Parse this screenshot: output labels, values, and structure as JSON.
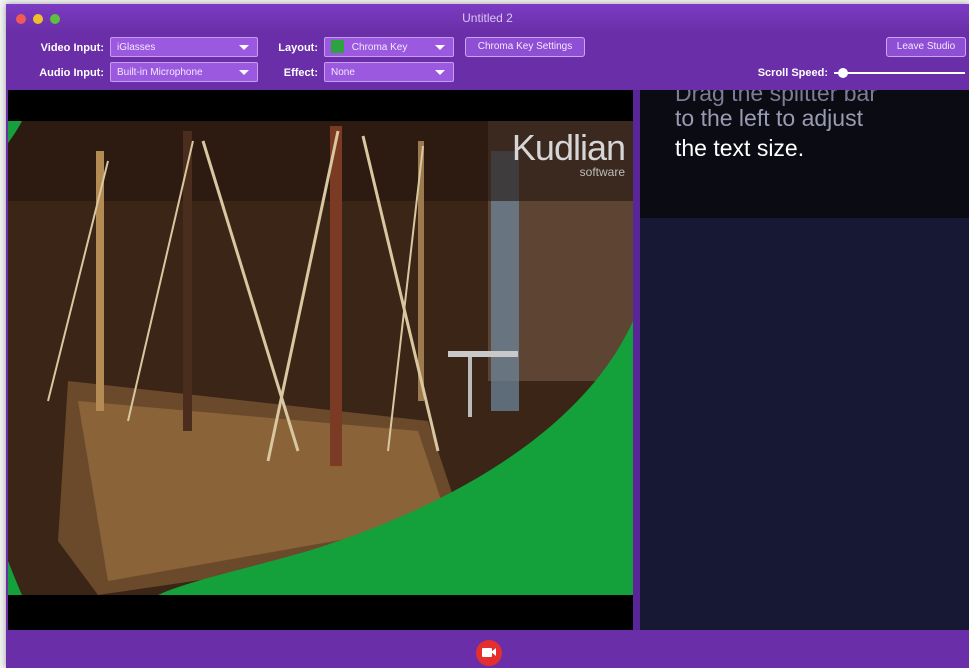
{
  "window": {
    "title": "Untitled 2"
  },
  "toolbar": {
    "video_input_label": "Video Input:",
    "video_input_value": "iGlasses",
    "audio_input_label": "Audio Input:",
    "audio_input_value": "Built-in Microphone",
    "layout_label": "Layout:",
    "layout_value": "Chroma Key",
    "effect_label": "Effect:",
    "effect_value": "None",
    "chroma_settings_button": "Chroma Key Settings",
    "leave_studio_button": "Leave Studio",
    "scroll_speed_label": "Scroll Speed:",
    "scroll_speed_fraction": 0.07
  },
  "video": {
    "watermark_brand": "Kudlian",
    "watermark_sub": "software"
  },
  "prompter": {
    "lines": [
      "Drag the splitter bar",
      "to the left to adjust",
      "the text size."
    ]
  },
  "colors": {
    "chrome_purple": "#6a2fa8",
    "chroma_green": "#14a03a",
    "prompter_bg": "#161834",
    "record_red": "#e52e2e"
  },
  "icons": {
    "record_button": "record-video-icon",
    "layout_swatch": "chroma-key-swatch-icon"
  }
}
